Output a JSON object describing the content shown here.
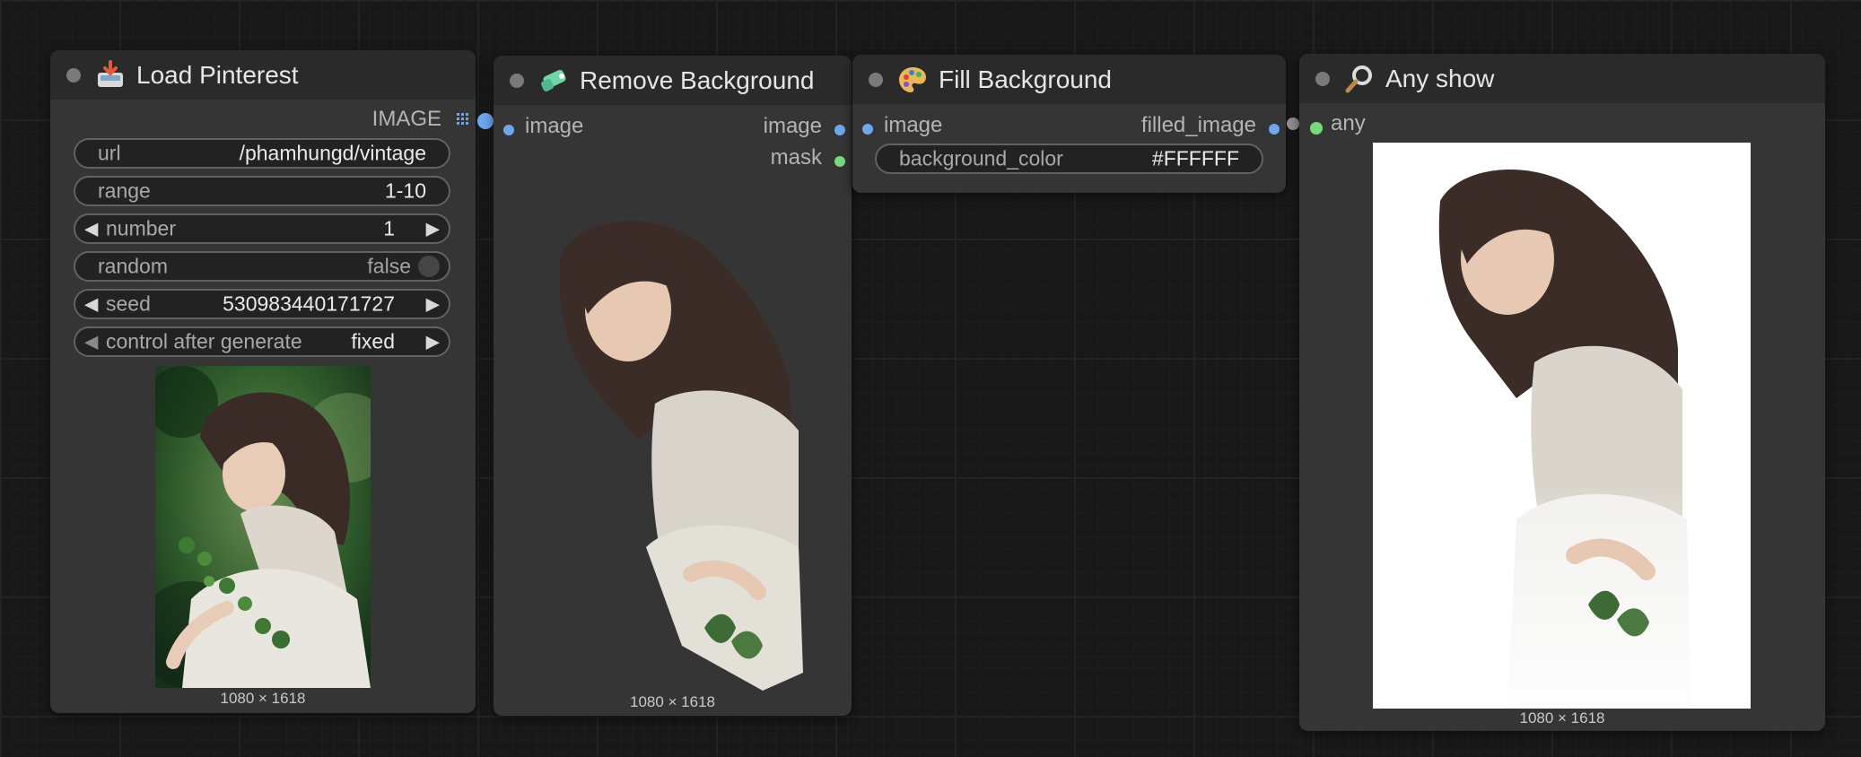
{
  "nodes": {
    "load_pinterest": {
      "title": "Load Pinterest",
      "output_label": "IMAGE",
      "widgets": {
        "url": {
          "label": "url",
          "value": "/phamhungd/vintage"
        },
        "range": {
          "label": "range",
          "value": "1-10"
        },
        "number": {
          "label": "number",
          "value": "1"
        },
        "random": {
          "label": "random",
          "value": "false"
        },
        "seed": {
          "label": "seed",
          "value": "530983440171727"
        },
        "control": {
          "label": "control after generate",
          "value": "fixed"
        }
      },
      "preview_dims": "1080 × 1618"
    },
    "remove_background": {
      "title": "Remove Background",
      "input_label": "image",
      "outputs": [
        "image",
        "mask"
      ],
      "preview_dims": "1080 × 1618"
    },
    "fill_background": {
      "title": "Fill Background",
      "input_label": "image",
      "output_label": "filled_image",
      "widgets": {
        "background_color": {
          "label": "background_color",
          "value": "#FFFFFF"
        }
      }
    },
    "any_show": {
      "title": "Any show",
      "input_label": "any",
      "preview_dims": "1080 × 1618"
    }
  },
  "icons": {
    "load_pinterest": "inbox-tray-icon",
    "remove_background": "eraser-icon",
    "fill_background": "palette-icon",
    "any_show": "magnifier-icon"
  },
  "colors": {
    "canvas": "#181818",
    "node_body": "#353535",
    "node_title": "#2a2a2a",
    "image_slot": "#6fa7ef",
    "mask_slot": "#76d97b",
    "fill_color": "#FFFFFF"
  }
}
